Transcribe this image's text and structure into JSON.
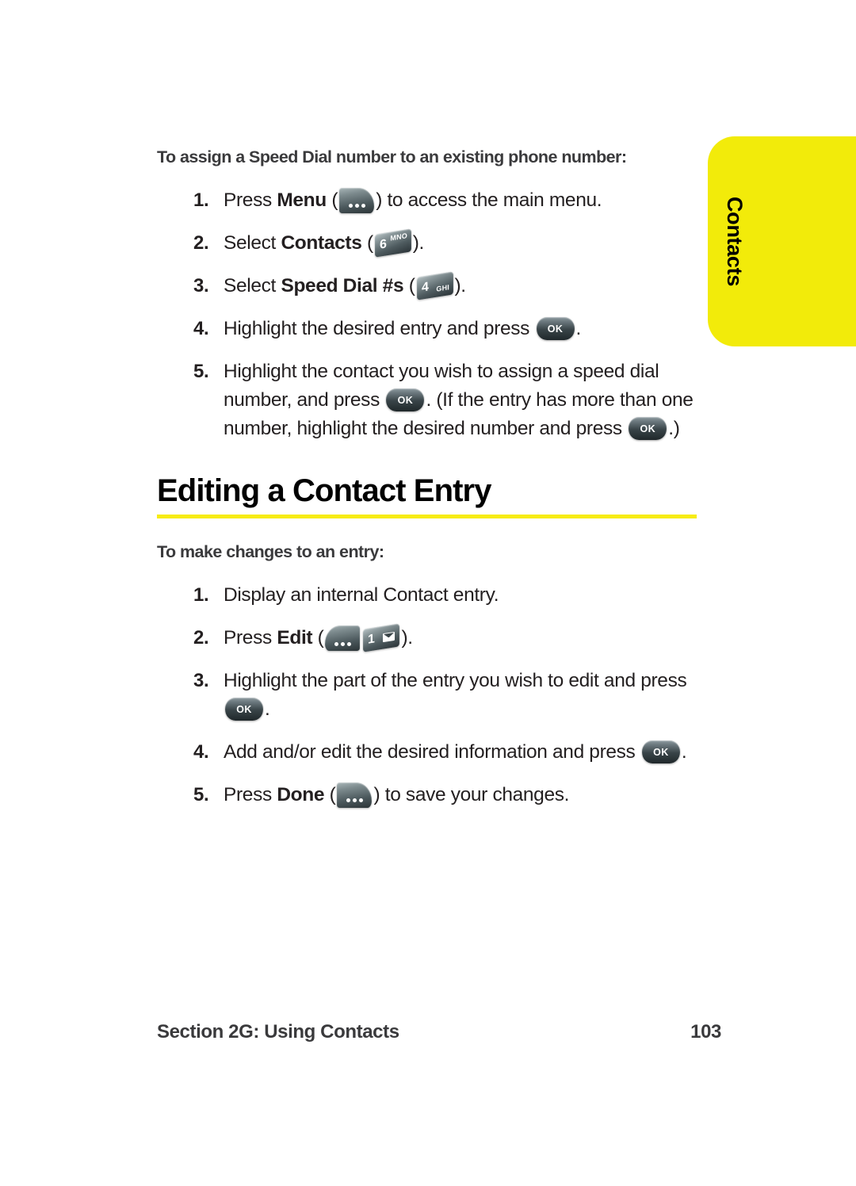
{
  "side_tab": {
    "label": "Contacts",
    "color": "#f2eb0a"
  },
  "procedure_one": {
    "title": "To assign a Speed Dial number to an existing phone number:",
    "steps": [
      {
        "num": "1.",
        "pre": "Press ",
        "bold": "Menu",
        "mid": " (",
        "icon": "softkey-left-menu-icon",
        "post": ") to access the main menu."
      },
      {
        "num": "2.",
        "pre": "Select ",
        "bold": "Contacts",
        "mid": " (",
        "icon": "key-6-mno-icon",
        "key_digit": "6",
        "key_letters": "MNO",
        "post": ")."
      },
      {
        "num": "3.",
        "pre": "Select ",
        "bold": "Speed Dial #s",
        "mid": " (",
        "icon": "key-4-ghi-icon",
        "key_digit": "4",
        "key_letters": "GHI",
        "post": ")."
      },
      {
        "num": "4.",
        "pre": "Highlight the desired entry and press ",
        "icon": "key-ok-icon",
        "key_label": "OK",
        "post": "."
      },
      {
        "num": "5.",
        "pre": "Highlight the contact you wish to assign a speed dial number, and press ",
        "icon": "key-ok-icon",
        "key_label": "OK",
        "mid2": ". (If the entry has more than one number, highlight the desired number and press ",
        "icon2": "key-ok-icon",
        "post": ".)"
      }
    ]
  },
  "section": {
    "heading": "Editing a Contact Entry",
    "rule_color": "#f7ec13"
  },
  "procedure_two": {
    "title": "To make changes to an entry:",
    "steps": [
      {
        "num": "1.",
        "pre": "Display an internal Contact entry."
      },
      {
        "num": "2.",
        "pre": "Press ",
        "bold": "Edit",
        "mid": " (",
        "icon": "softkey-right-edit-icon",
        "icon2": "key-1-mail-icon",
        "key_digit": "1",
        "post": ")."
      },
      {
        "num": "3.",
        "pre": "Highlight the part of the entry you wish to edit and press ",
        "icon": "key-ok-icon",
        "key_label": "OK",
        "post": "."
      },
      {
        "num": "4.",
        "pre": "Add and/or edit the desired information and press ",
        "icon": "key-ok-icon",
        "key_label": "OK",
        "post": "."
      },
      {
        "num": "5.",
        "pre": "Press ",
        "bold": "Done",
        "mid": " (",
        "icon": "softkey-left-done-icon",
        "post": ") to save your changes."
      }
    ]
  },
  "footer": {
    "left": "Section 2G: Using Contacts",
    "page_number": "103"
  }
}
